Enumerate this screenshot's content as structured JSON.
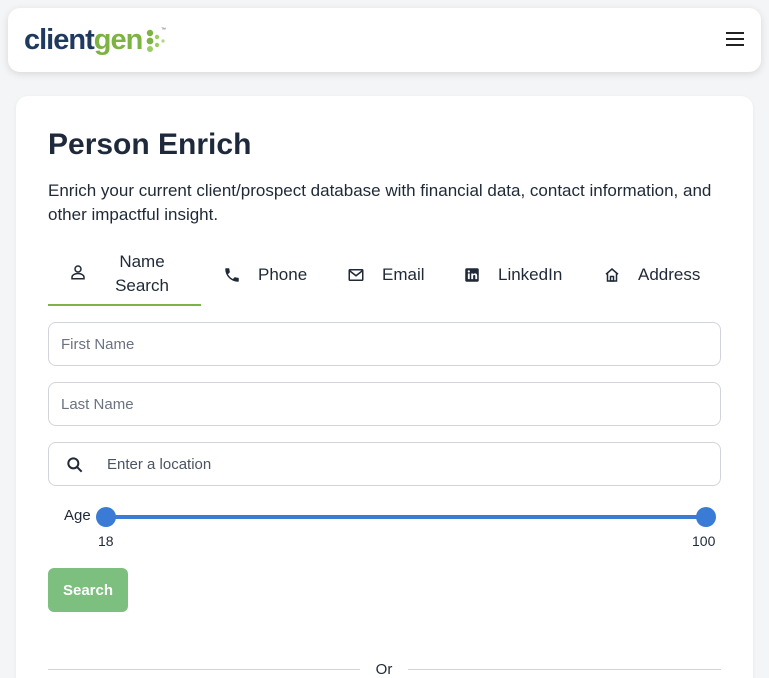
{
  "header": {
    "logo_part1": "client",
    "logo_part2": "gen",
    "logo_tm": "™",
    "menu_icon": "hamburger-menu-icon"
  },
  "page": {
    "title": "Person Enrich",
    "description": "Enrich your current client/prospect database with financial data, contact information, and other impactful insight."
  },
  "tabs": [
    {
      "label_line1": "Name",
      "label_line2": "Search",
      "icon": "person-icon",
      "active": true
    },
    {
      "label": "Phone",
      "icon": "phone-icon",
      "active": false
    },
    {
      "label": "Email",
      "icon": "mail-icon",
      "active": false
    },
    {
      "label": "LinkedIn",
      "icon": "linkedin-icon",
      "active": false
    },
    {
      "label": "Address",
      "icon": "home-icon",
      "active": false
    }
  ],
  "form": {
    "first_name_placeholder": "First Name",
    "last_name_placeholder": "Last Name",
    "location_placeholder": "Enter a location",
    "age_label": "Age",
    "age_min": "18",
    "age_max": "100",
    "search_label": "Search",
    "or_label": "Or"
  },
  "colors": {
    "accent_green": "#7cb342",
    "button_green": "#7cbf7e",
    "slider_blue": "#3a7bd5",
    "logo_navy": "#1e3a5f"
  }
}
